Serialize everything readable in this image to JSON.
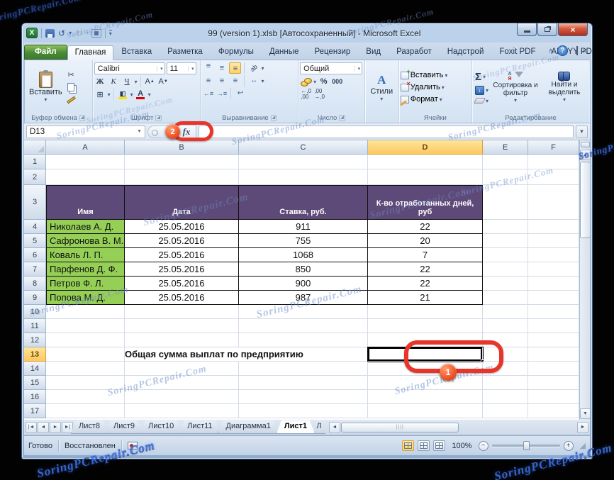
{
  "titlebar": {
    "title": "99 (version 1).xlsb [Автосохраненный]  -  Microsoft Excel"
  },
  "tabs": {
    "items": [
      "Файл",
      "Главная",
      "Вставка",
      "Разметка",
      "Формулы",
      "Данные",
      "Рецензир",
      "Вид",
      "Разработ",
      "Надстрой",
      "Foxit PDF",
      "ABBYY PD"
    ],
    "active": "Главная"
  },
  "ribbon": {
    "clipboard": {
      "paste": "Вставить",
      "label": "Буфер обмена"
    },
    "font": {
      "name": "Calibri",
      "size": "11",
      "bold": "Ж",
      "italic": "К",
      "underline": "Ч",
      "label": "Шрифт"
    },
    "alignment": {
      "label": "Выравнивание"
    },
    "number": {
      "format": "Общий",
      "percent": "%",
      "thousands": "000",
      "label": "Число"
    },
    "styles": {
      "label": "Стили"
    },
    "cells": {
      "insert": "Вставить",
      "delete": "Удалить",
      "format": "Формат",
      "label": "Ячейки"
    },
    "editing": {
      "sigma": "Σ",
      "sort": "Сортировка и фильтр",
      "find": "Найти и выделить",
      "label": "Редактирование"
    }
  },
  "formula_bar": {
    "name_box": "D13",
    "fx": "fx"
  },
  "grid": {
    "columns": [
      "A",
      "B",
      "C",
      "D",
      "E",
      "F"
    ],
    "rows": [
      1,
      2,
      3,
      4,
      5,
      6,
      7,
      8,
      9,
      10,
      11,
      12,
      13,
      14,
      15,
      16,
      17
    ],
    "selected_column": "D",
    "selected_row": 13
  },
  "sheet": {
    "table": {
      "header_row": 3,
      "first_data_row": 4,
      "headers": [
        "Имя",
        "Дата",
        "Ставка, руб.",
        "К-во отработанных дней, руб"
      ],
      "rows": [
        [
          "Николаев А. Д.",
          "25.05.2016",
          "911",
          "22"
        ],
        [
          "Сафронова В. М.",
          "25.05.2016",
          "755",
          "20"
        ],
        [
          "Коваль Л. П.",
          "25.05.2016",
          "1068",
          "7"
        ],
        [
          "Парфенов Д. Ф.",
          "25.05.2016",
          "850",
          "22"
        ],
        [
          "Петров Ф. Л.",
          "25.05.2016",
          "900",
          "22"
        ],
        [
          "Попова М. Д.",
          "25.05.2016",
          "987",
          "21"
        ]
      ]
    },
    "summary_label": "Общая сумма выплат по предприятию",
    "summary_row": 13,
    "selected_cell": "D13"
  },
  "sheet_tabs": {
    "items": [
      "Лист8",
      "Лист9",
      "Лист10",
      "Лист11",
      "Диаграмма1",
      "Лист1"
    ],
    "active": "Лист1",
    "partial": "Л"
  },
  "status_bar": {
    "ready": "Готово",
    "restored": "Восстановлен",
    "zoom": "100%"
  },
  "annotations": {
    "badge_cell": "1",
    "badge_fx": "2"
  },
  "watermark": {
    "text": "SoringPCRepair.Com"
  },
  "colors": {
    "header_purple": "#5e4a78",
    "name_green": "#95cf55",
    "selected_header": "#fcd46b",
    "annotation_red": "#e8352a",
    "badge_orange": "#f1562c",
    "file_tab_green": "#4a8a36"
  }
}
